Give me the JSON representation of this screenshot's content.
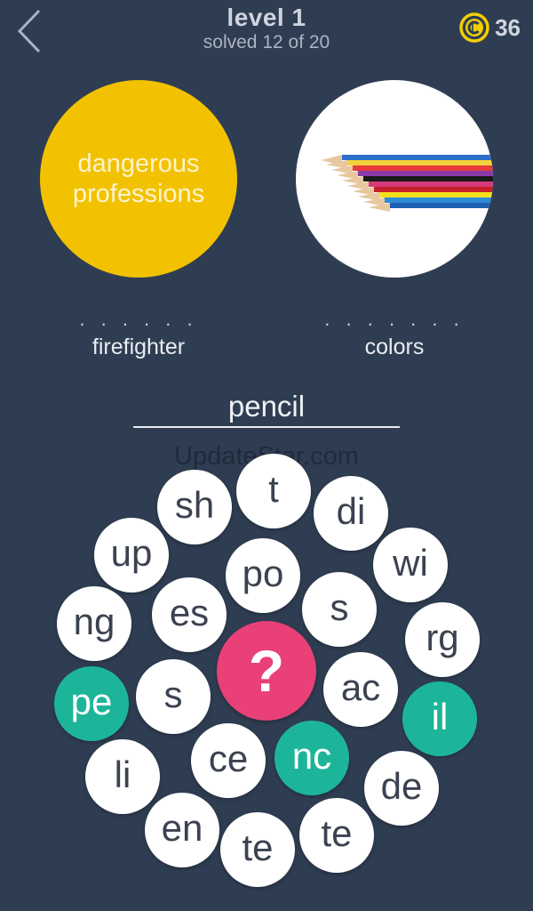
{
  "header": {
    "title": "level 1",
    "subtitle": "solved 12 of 20",
    "coins": "36"
  },
  "clues": {
    "left": {
      "text": "dangerous professions",
      "dots": ". . . . . .",
      "word": "firefighter",
      "color": "#f2c200"
    },
    "right": {
      "image": "colored-pencils",
      "dots": ". . . . . . .",
      "word": "colors"
    }
  },
  "answer": {
    "word": "pencil"
  },
  "watermark": "UpdateStar.com",
  "tiles": [
    {
      "label": "sh",
      "selected": false
    },
    {
      "label": "t",
      "selected": false
    },
    {
      "label": "di",
      "selected": false
    },
    {
      "label": "up",
      "selected": false
    },
    {
      "label": "po",
      "selected": false
    },
    {
      "label": "wi",
      "selected": false
    },
    {
      "label": "ng",
      "selected": false
    },
    {
      "label": "es",
      "selected": false
    },
    {
      "label": "s",
      "selected": false
    },
    {
      "label": "rg",
      "selected": false
    },
    {
      "label": "pe",
      "selected": true
    },
    {
      "label": "s",
      "selected": false
    },
    {
      "label": "ac",
      "selected": false
    },
    {
      "label": "il",
      "selected": true
    },
    {
      "label": "li",
      "selected": false
    },
    {
      "label": "ce",
      "selected": false
    },
    {
      "label": "nc",
      "selected": true
    },
    {
      "label": "de",
      "selected": false
    },
    {
      "label": "en",
      "selected": false
    },
    {
      "label": "te",
      "selected": false
    },
    {
      "label": "te",
      "selected": false
    }
  ],
  "hint": {
    "label": "?",
    "color": "#e94078"
  },
  "colors": {
    "background": "#2f3d52",
    "selected_tile": "#1db59a",
    "coin": "#f2d000"
  }
}
